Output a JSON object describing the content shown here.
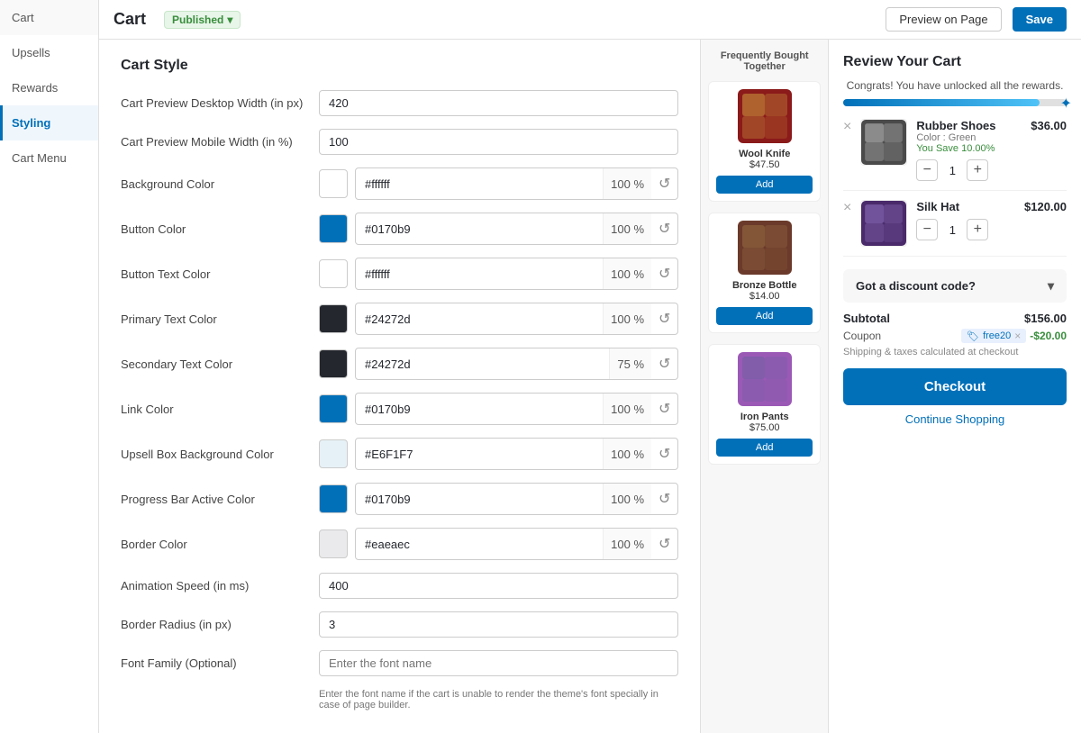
{
  "header": {
    "title": "Cart",
    "published_label": "Published",
    "chevron": "▾",
    "preview_label": "Preview on Page",
    "save_label": "Save"
  },
  "sidebar": {
    "items": [
      {
        "id": "cart",
        "label": "Cart"
      },
      {
        "id": "upsells",
        "label": "Upsells"
      },
      {
        "id": "rewards",
        "label": "Rewards"
      },
      {
        "id": "styling",
        "label": "Styling",
        "active": true
      },
      {
        "id": "cart-menu",
        "label": "Cart Menu"
      }
    ]
  },
  "settings": {
    "section_title": "Cart Style",
    "fields": [
      {
        "id": "desktop-width",
        "label": "Cart Preview Desktop Width (in px)",
        "value": "420",
        "type": "input"
      },
      {
        "id": "mobile-width",
        "label": "Cart Preview Mobile Width (in %)",
        "value": "100",
        "type": "input"
      }
    ],
    "colors": [
      {
        "id": "background-color",
        "label": "Background Color",
        "swatch": "#ffffff",
        "hex": "#ffffff",
        "pct": "100"
      },
      {
        "id": "button-color",
        "label": "Button Color",
        "swatch": "#0170b9",
        "hex": "#0170b9",
        "pct": "100"
      },
      {
        "id": "button-text-color",
        "label": "Button Text Color",
        "swatch": "#ffffff",
        "hex": "#ffffff",
        "pct": "100"
      },
      {
        "id": "primary-text-color",
        "label": "Primary Text Color",
        "swatch": "#24272d",
        "hex": "#24272d",
        "pct": "100"
      },
      {
        "id": "secondary-text-color",
        "label": "Secondary Text Color",
        "swatch": "#24272d",
        "hex": "#24272d",
        "pct": "75"
      },
      {
        "id": "link-color",
        "label": "Link Color",
        "swatch": "#0170b9",
        "hex": "#0170b9",
        "pct": "100"
      },
      {
        "id": "upsell-box-color",
        "label": "Upsell Box Background Color",
        "swatch": "#e6f1f7",
        "hex": "#E6F1F7",
        "pct": "100"
      },
      {
        "id": "progress-bar-color",
        "label": "Progress Bar Active Color",
        "swatch": "#0170b9",
        "hex": "#0170b9",
        "pct": "100"
      },
      {
        "id": "border-color",
        "label": "Border Color",
        "swatch": "#eaeaec",
        "hex": "#eaeaec",
        "pct": "100"
      }
    ],
    "other_fields": [
      {
        "id": "animation-speed",
        "label": "Animation Speed (in ms)",
        "value": "400"
      },
      {
        "id": "border-radius",
        "label": "Border Radius (in px)",
        "value": "3"
      },
      {
        "id": "font-family",
        "label": "Font Family (Optional)",
        "value": "",
        "placeholder": "Enter the font name"
      }
    ],
    "font_note": "Enter the font name if the cart is unable to render the theme's font specially in case of page builder."
  },
  "preview": {
    "section_title": "Frequently Bought Together",
    "products": [
      {
        "name": "Wool Knife",
        "price": "$47.50",
        "add_label": "Add",
        "color1": "#b87333",
        "color2": "#8b1a1a"
      },
      {
        "name": "Bronze Bottle",
        "price": "$14.00",
        "add_label": "Add",
        "color1": "#8b5e3c",
        "color2": "#6b3a2a"
      },
      {
        "name": "Iron Pants",
        "price": "$75.00",
        "add_label": "Add",
        "color1": "#7b5ea7",
        "color2": "#9b59b6"
      }
    ]
  },
  "cart": {
    "title": "Review Your Cart",
    "congrats": "Congrats! You have unlocked all the rewards.",
    "progress_pct": 88,
    "items": [
      {
        "name": "Rubber Shoes",
        "color": "Color : Green",
        "price": "$36.00",
        "save": "You Save 10.00%",
        "qty": 1,
        "color1": "#9b9b9b",
        "color2": "#4a4a4a"
      },
      {
        "name": "Silk Hat",
        "color": "",
        "price": "$120.00",
        "save": "",
        "qty": 1,
        "color1": "#7b5ea7",
        "color2": "#4a2a6a"
      }
    ],
    "discount_label": "Got a discount code?",
    "subtotal_label": "Subtotal",
    "subtotal_value": "$156.00",
    "coupon_label": "Coupon",
    "coupon_code": "free20",
    "coupon_amount": "-$20.00",
    "shipping_note": "Shipping & taxes calculated at checkout",
    "checkout_label": "Checkout",
    "continue_label": "Continue Shopping"
  },
  "icons": {
    "check": "✓",
    "star": "✦",
    "chevron_down": "▾",
    "reset": "↺",
    "minus": "−",
    "plus": "+",
    "close": "×",
    "tag": "🏷"
  }
}
